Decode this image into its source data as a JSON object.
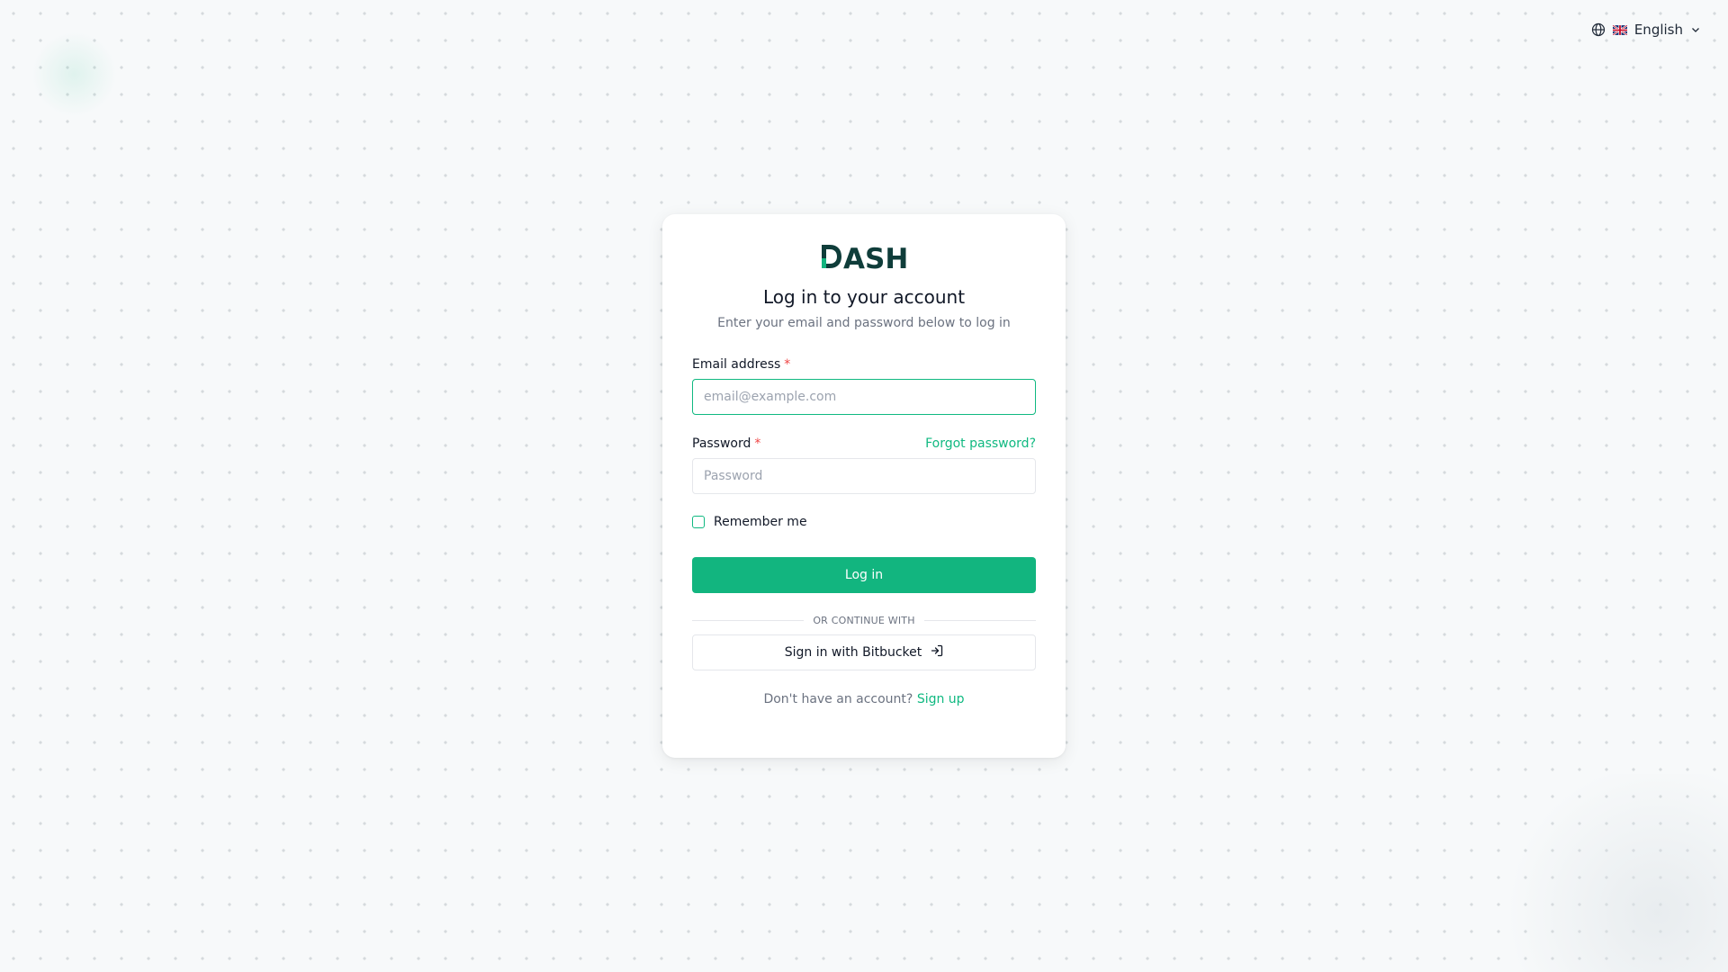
{
  "language": {
    "label": "English",
    "icon": "globe-icon",
    "flag": "uk-flag-icon",
    "chevron": "chevron-down-icon"
  },
  "brand": {
    "logo_text": "DASH",
    "color": "#0f3d3a",
    "accent": "#12b57f"
  },
  "header": {
    "title": "Log in to your account",
    "subtitle": "Enter your email and password below to log in"
  },
  "form": {
    "email": {
      "label": "Email address",
      "required_mark": "*",
      "placeholder": "email@example.com",
      "value": ""
    },
    "password": {
      "label": "Password",
      "required_mark": "*",
      "placeholder": "Password",
      "value": "",
      "forgot_label": "Forgot password?"
    },
    "remember": {
      "label": "Remember me",
      "checked": false
    },
    "submit_label": "Log in"
  },
  "oauth": {
    "divider_text": "OR CONTINUE WITH",
    "bitbucket_label": "Sign in with Bitbucket",
    "bitbucket_icon": "sign-in-icon"
  },
  "footer": {
    "prompt": "Don't have an account?",
    "signup_label": "Sign up"
  },
  "colors": {
    "accent": "#12b57f",
    "link": "#10b981",
    "required": "#ef4444",
    "background": "#f7f9fa"
  }
}
